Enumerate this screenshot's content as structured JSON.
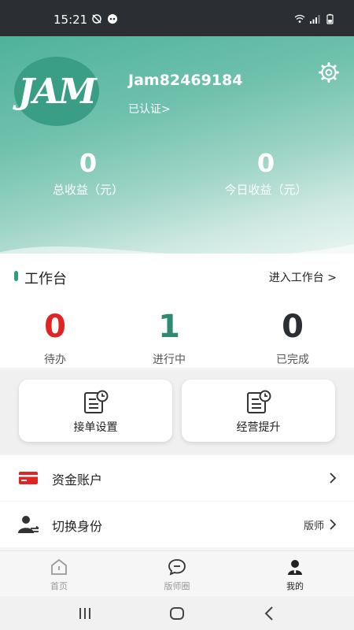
{
  "status_bar": {
    "time": "15:21"
  },
  "profile": {
    "avatar_text": "JAM",
    "username": "Jam82469184",
    "verified_label": "已认证>"
  },
  "earnings": {
    "total_value": "0",
    "total_label": "总收益（元）",
    "today_value": "0",
    "today_label": "今日收益（元）"
  },
  "workbench": {
    "title": "工作台",
    "enter_label": "进入工作台 >",
    "counters": [
      {
        "value": "0",
        "label": "待办",
        "color": "#e02424"
      },
      {
        "value": "1",
        "label": "进行中",
        "color": "#2f8a72"
      },
      {
        "value": "0",
        "label": "已完成",
        "color": "#2b2e33"
      }
    ]
  },
  "cards": [
    {
      "label": "接单设置",
      "icon": "order-settings-icon"
    },
    {
      "label": "经营提升",
      "icon": "business-improve-icon"
    }
  ],
  "menu": {
    "wallet_label": "资金账户",
    "switch_label": "切换身份",
    "switch_value": "版师"
  },
  "bottom_nav": [
    {
      "label": "首页",
      "icon": "home-icon"
    },
    {
      "label": "版师圈",
      "icon": "chat-icon"
    },
    {
      "label": "我的",
      "icon": "user-icon",
      "active": true
    }
  ],
  "colors": {
    "brand_green": "#2f9b80",
    "todo_red": "#e02424",
    "status_bar": "#2b2e33"
  }
}
